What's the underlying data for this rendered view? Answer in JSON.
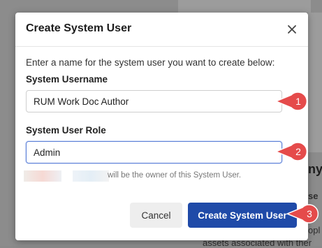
{
  "background": {
    "heading_fragment": "ny",
    "text_fragment_1": "se",
    "text_fragment_2": "opl",
    "text_fragment_3": "assets associated with ther"
  },
  "dialog": {
    "title": "Create System User",
    "close_icon": "close-icon",
    "prompt": "Enter a name for the system user you want to create below:",
    "username_label": "System Username",
    "username_value": "RUM Work Doc Author",
    "role_label": "System User Role",
    "role_value": "Admin",
    "owner_note": "will be the owner of this System User.",
    "cancel_label": "Cancel",
    "create_label": "Create System User"
  },
  "callouts": [
    "1",
    "2",
    "3"
  ],
  "colors": {
    "primary": "#1f4aa8",
    "callout": "#e54b4b",
    "focus_border": "#5b7fd6"
  }
}
